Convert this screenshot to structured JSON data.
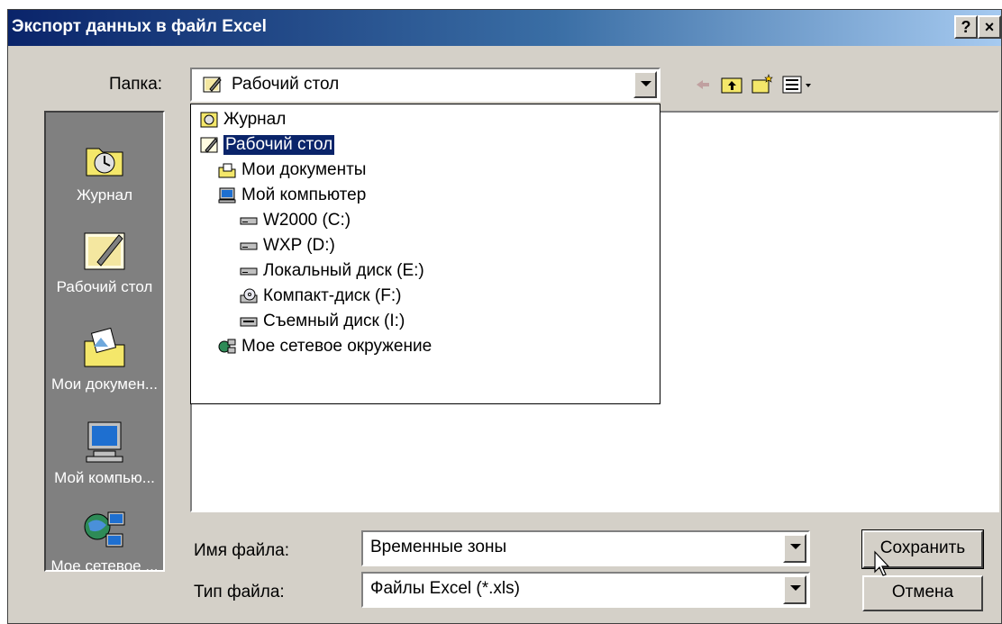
{
  "window": {
    "title": "Экспорт данных в файл Excel",
    "help_label": "?",
    "close_label": "×"
  },
  "folder": {
    "label": "Папка:",
    "current": "Рабочий стол"
  },
  "dropdown": {
    "items": [
      {
        "label": "Журнал",
        "icon": "history-icon"
      },
      {
        "label": "Рабочий стол",
        "icon": "desktop-icon"
      },
      {
        "label": "Мои документы",
        "icon": "my-documents-icon"
      },
      {
        "label": "Мой компьютер",
        "icon": "computer-icon"
      },
      {
        "label": "W2000 (C:)",
        "icon": "hard-drive-icon"
      },
      {
        "label": "WXP (D:)",
        "icon": "hard-drive-icon"
      },
      {
        "label": "Локальный диск (E:)",
        "icon": "hard-drive-icon"
      },
      {
        "label": "Компакт-диск (F:)",
        "icon": "cd-drive-icon"
      },
      {
        "label": "Съемный диск (I:)",
        "icon": "removable-drive-icon"
      },
      {
        "label": "Мое сетевое окружение",
        "icon": "network-icon"
      }
    ]
  },
  "places": [
    {
      "label": "Журнал"
    },
    {
      "label": "Рабочий стол"
    },
    {
      "label": "Мои докумен..."
    },
    {
      "label": "Мой компью..."
    },
    {
      "label": "Мое сетевое ..."
    }
  ],
  "filename": {
    "label": "Имя файла:",
    "value": "Временные зоны"
  },
  "filetype": {
    "label": "Тип файла:",
    "value": "Файлы Excel (*.xls)"
  },
  "buttons": {
    "save": "Сохранить",
    "cancel": "Отмена"
  },
  "colors": {
    "title_start": "#0a246a",
    "title_end": "#a6caf0",
    "face": "#d4d0c8",
    "selection": "#0a246a"
  }
}
